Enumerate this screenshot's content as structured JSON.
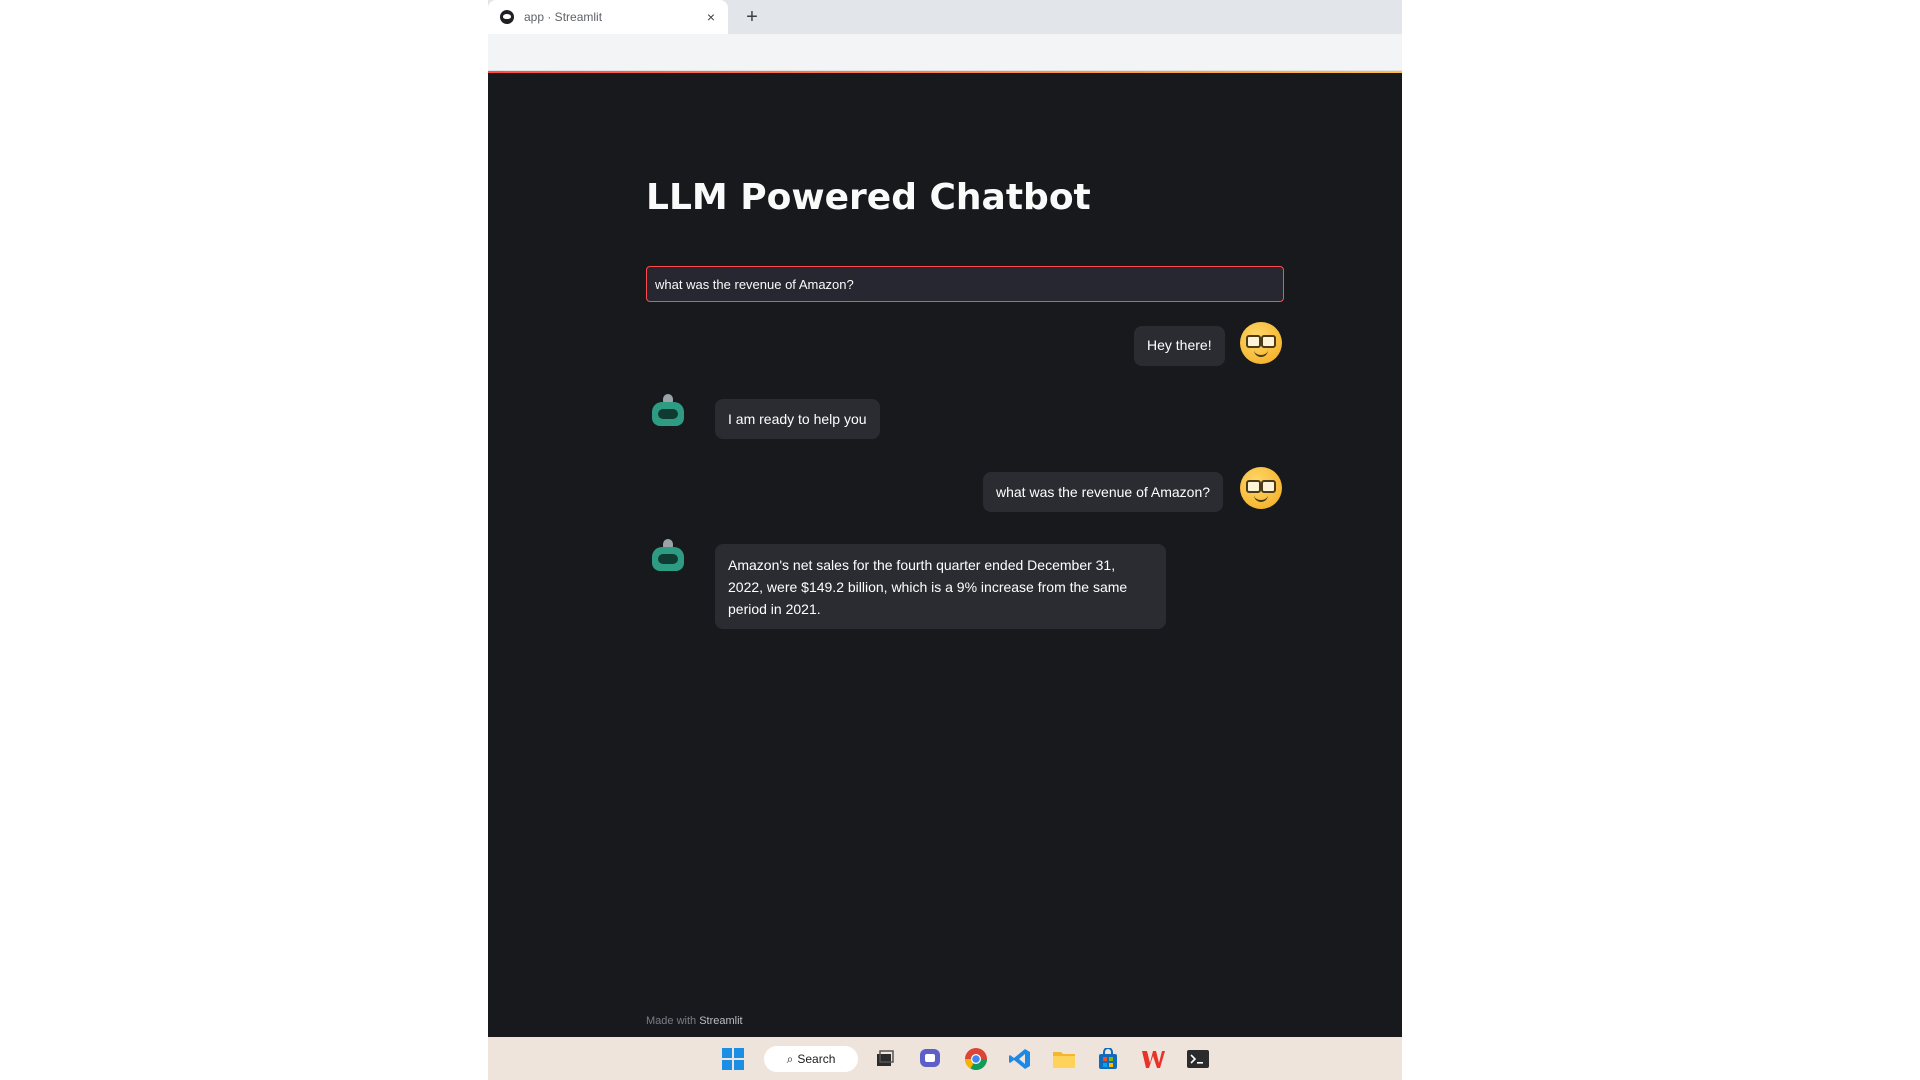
{
  "browser": {
    "tab_title": "app · Streamlit",
    "close_glyph": "×",
    "new_tab_glyph": "+"
  },
  "app": {
    "title": "LLM Powered Chatbot",
    "input_value": "what was the revenue of Amazon?",
    "accent_color": "#ff4b4b",
    "background_color": "#17191d",
    "bubble_color": "#2a2c31"
  },
  "messages": [
    {
      "role": "user",
      "text": "Hey there!"
    },
    {
      "role": "bot",
      "text": "I am ready to help you"
    },
    {
      "role": "user",
      "text": "what was the revenue of Amazon?"
    },
    {
      "role": "bot",
      "text": "Amazon's net sales for the fourth quarter ended December 31, 2022, were $149.2 billion, which is a 9% increase from the same period in 2021."
    }
  ],
  "footer": {
    "made_with": "Made with",
    "brand": "Streamlit"
  },
  "taskbar": {
    "search_label": "Search",
    "search_icon": "magnifier-icon",
    "apps": [
      "windows-start-icon",
      "task-view-icon",
      "teams-chat-icon",
      "chrome-icon",
      "vscode-icon",
      "file-explorer-icon",
      "store-icon",
      "wps-office-icon",
      "terminal-icon"
    ]
  }
}
